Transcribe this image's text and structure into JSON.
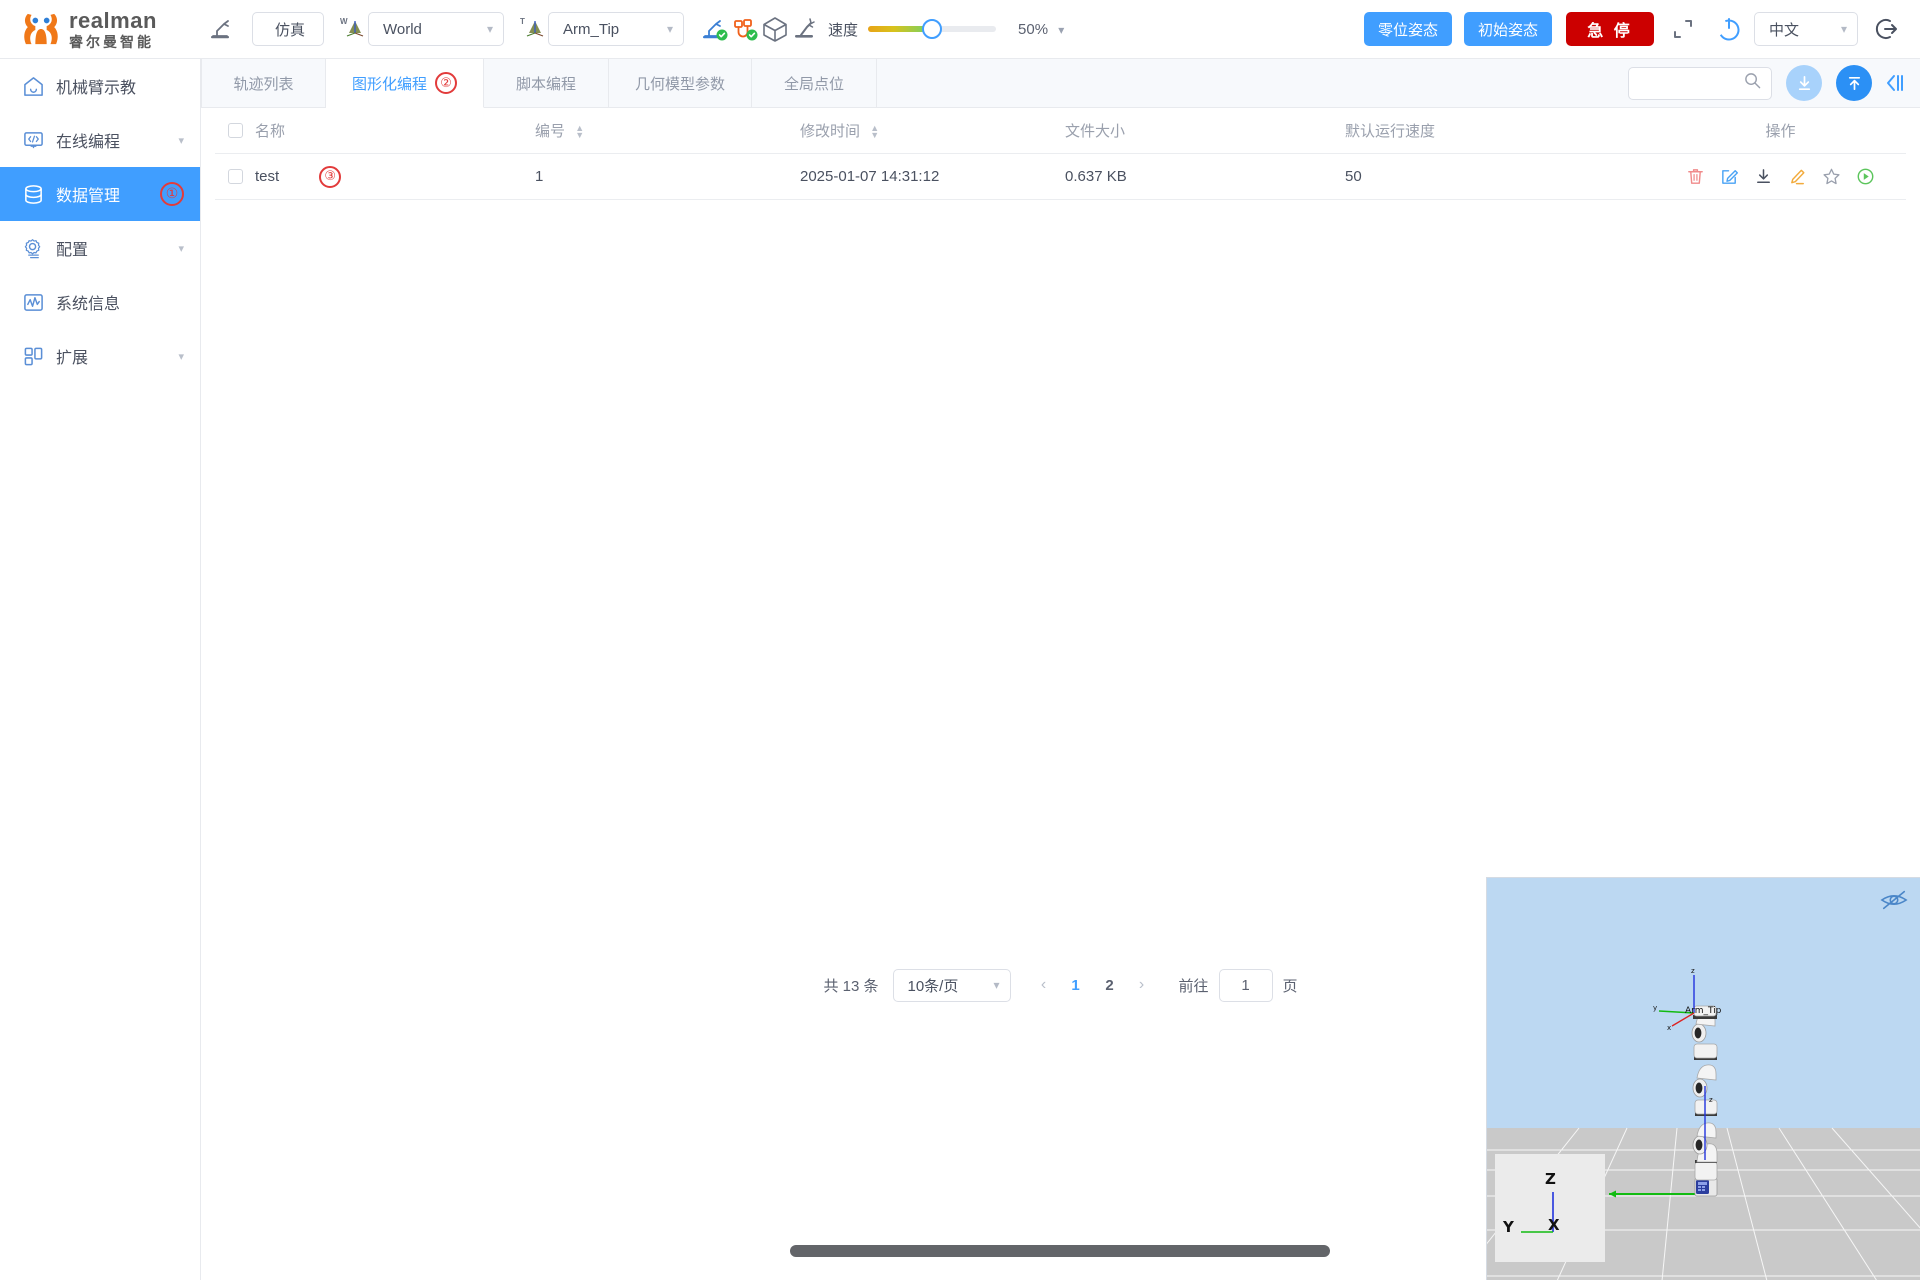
{
  "brand": {
    "en": "realman",
    "cn": "睿尔曼智能",
    "logo_color": "#f07818"
  },
  "toolbar": {
    "teach_icon": "robot-arm-icon",
    "sim_mode": "仿真",
    "world_frame_label": "W",
    "world_frame": "World",
    "tool_frame_label": "T",
    "tool_frame": "Arm_Tip",
    "status_icons": [
      "robot-connected-icon",
      "cable-connected-icon",
      "cube-icon",
      "collision-icon"
    ],
    "speed_label": "速度",
    "speed_percent": "50%",
    "speed_value": 50,
    "zero_pose": "零位姿态",
    "init_pose": "初始姿态",
    "emergency_stop": "急 停",
    "fullscreen_icon": "fullscreen-icon",
    "power_icon": "power-icon",
    "language": "中文",
    "logout_icon": "logout-icon",
    "accent": "#409eff",
    "danger": "#cc0000"
  },
  "sidebar": {
    "items": [
      {
        "label": "机械臂示教",
        "icon": "home-icon",
        "caret": false,
        "active": false,
        "marker": ""
      },
      {
        "label": "在线编程",
        "icon": "code-monitor-icon",
        "caret": true,
        "active": false,
        "marker": ""
      },
      {
        "label": "数据管理",
        "icon": "database-icon",
        "caret": false,
        "active": true,
        "marker": "①"
      },
      {
        "label": "配置",
        "icon": "gear-icon",
        "caret": true,
        "active": false,
        "marker": ""
      },
      {
        "label": "系统信息",
        "icon": "waveform-icon",
        "caret": false,
        "active": false,
        "marker": ""
      },
      {
        "label": "扩展",
        "icon": "grid-blocks-icon",
        "caret": true,
        "active": false,
        "marker": ""
      }
    ]
  },
  "tabs": [
    {
      "label": "轨迹列表",
      "active": false,
      "marker": ""
    },
    {
      "label": "图形化编程",
      "active": true,
      "marker": "②"
    },
    {
      "label": "脚本编程",
      "active": false,
      "marker": ""
    },
    {
      "label": "几何模型参数",
      "active": false,
      "marker": ""
    },
    {
      "label": "全局点位",
      "active": false,
      "marker": ""
    }
  ],
  "search": {
    "value": "",
    "placeholder": "",
    "icon": "search-icon"
  },
  "tab_actions": {
    "download_icon": "download-circle-icon",
    "upload_icon": "upload-circle-icon",
    "collapse_icon": "collapse-panel-icon"
  },
  "table": {
    "columns": [
      {
        "key": "name",
        "label": "名称",
        "sortable": false
      },
      {
        "key": "no",
        "label": "编号",
        "sortable": true
      },
      {
        "key": "time",
        "label": "修改时间",
        "sortable": true
      },
      {
        "key": "size",
        "label": "文件大小",
        "sortable": false
      },
      {
        "key": "speed",
        "label": "默认运行速度",
        "sortable": false
      },
      {
        "key": "actions",
        "label": "操作",
        "sortable": false
      }
    ],
    "rows": [
      {
        "name": "test",
        "marker": "③",
        "no": "1",
        "time": "2025-01-07 14:31:12",
        "size": "0.637 KB",
        "speed": "50",
        "actions": [
          "delete-icon",
          "edit-file-icon",
          "download-icon",
          "rename-pencil-icon",
          "favorite-star-icon",
          "run-play-icon"
        ]
      }
    ],
    "action_colors": {
      "delete": "#f08b8b",
      "edit": "#4aa3f5",
      "download": "#4a5160",
      "rename": "#f2ab3c",
      "star": "#9aa0ad",
      "run": "#5cc55c"
    }
  },
  "pagination": {
    "total_text": "共 13 条",
    "total": 13,
    "page_size": "10条/页",
    "prev_icon": "chevron-left-icon",
    "next_icon": "chevron-right-icon",
    "pages": [
      "1",
      "2"
    ],
    "current_page": "1",
    "goto_label": "前往",
    "goto_value": "1",
    "goto_suffix": "页"
  },
  "viewport": {
    "eye_icon": "eye-hidden-icon",
    "tip_label": "Arm_Tip",
    "axis_z": "Z",
    "axis_y": "Y",
    "axis_x": "X",
    "sky_color": "#bcd8f2",
    "ground_color": "#c9c9c9"
  },
  "scrollbar": {
    "name": "horizontal-scrollbar"
  }
}
